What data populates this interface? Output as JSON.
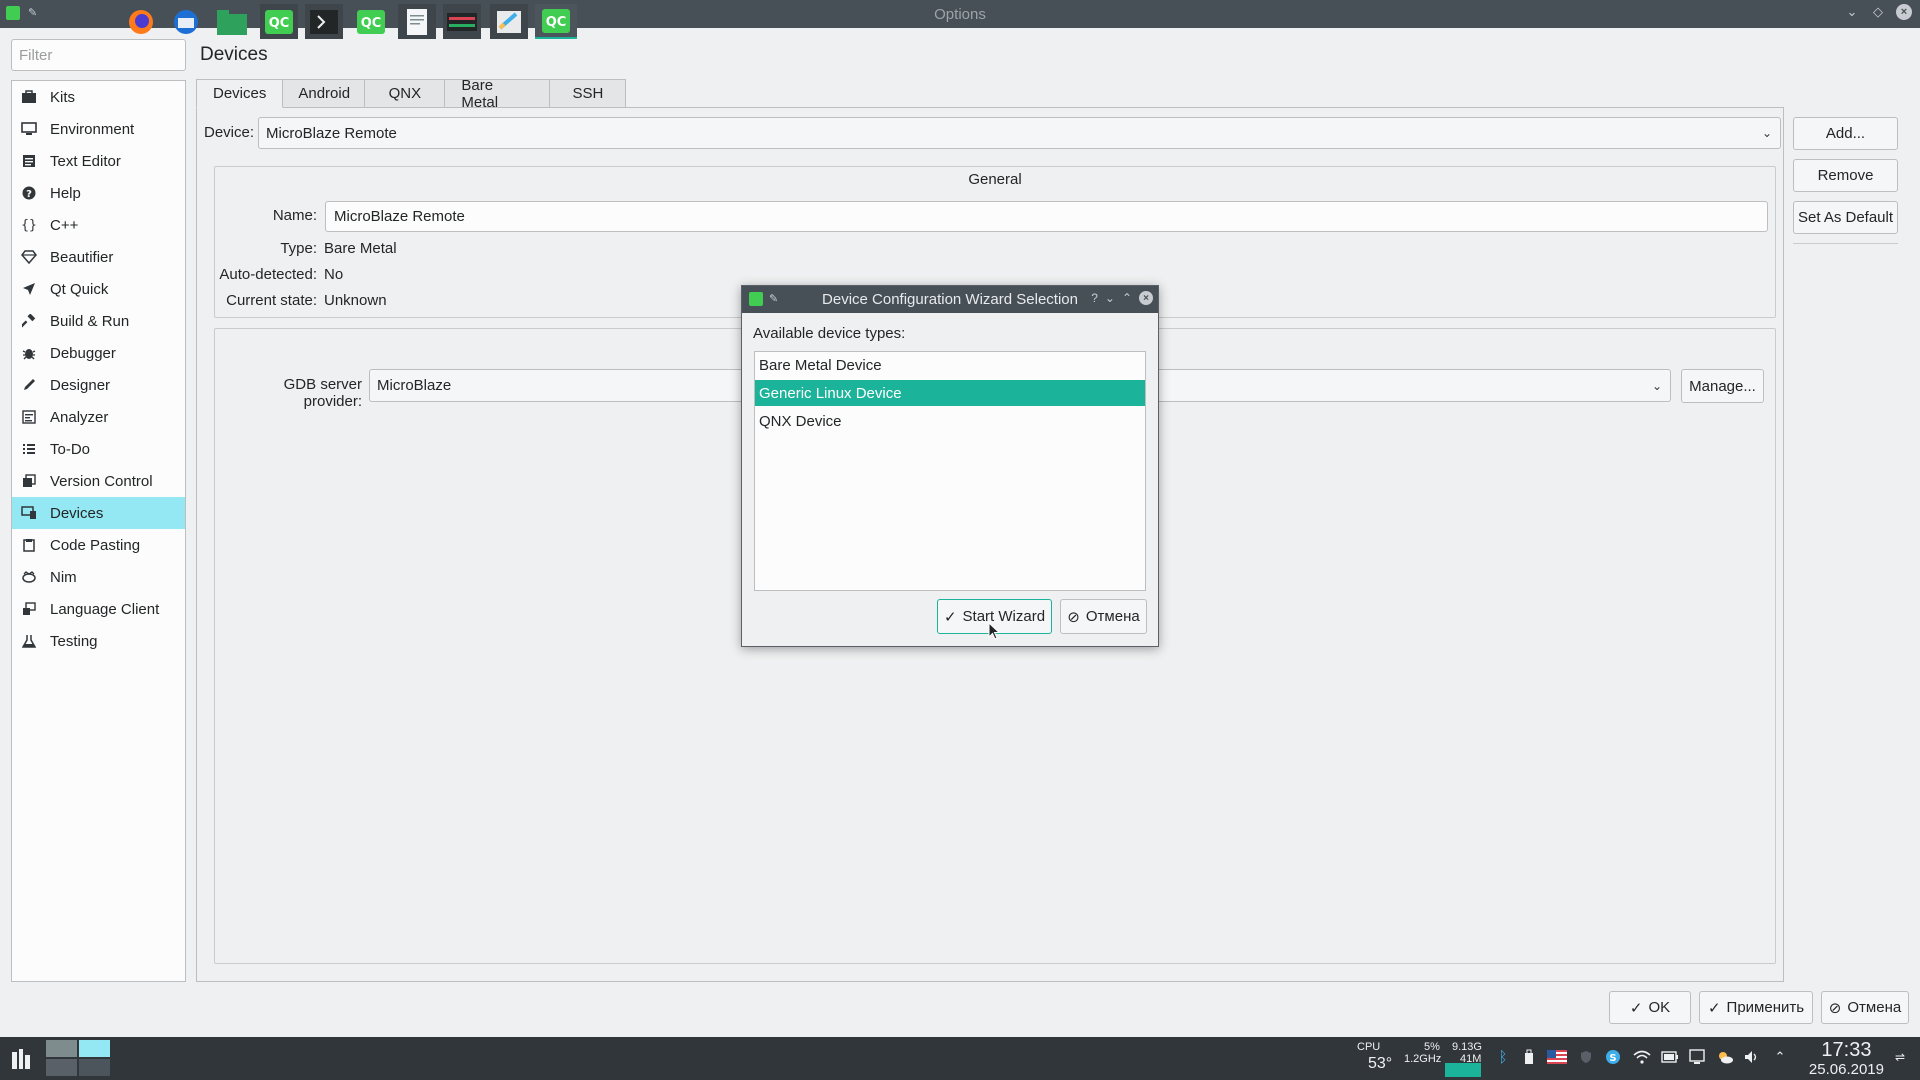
{
  "window": {
    "title": "Options"
  },
  "sidebar": {
    "filter_placeholder": "Filter",
    "items": [
      {
        "label": "Kits",
        "icon": "kits-icon"
      },
      {
        "label": "Environment",
        "icon": "monitor-icon"
      },
      {
        "label": "Text Editor",
        "icon": "text-editor-icon"
      },
      {
        "label": "Help",
        "icon": "help-icon"
      },
      {
        "label": "C++",
        "icon": "braces-icon"
      },
      {
        "label": "Beautifier",
        "icon": "diamond-icon"
      },
      {
        "label": "Qt Quick",
        "icon": "paper-plane-icon"
      },
      {
        "label": "Build & Run",
        "icon": "hammer-icon"
      },
      {
        "label": "Debugger",
        "icon": "bug-icon"
      },
      {
        "label": "Designer",
        "icon": "pencil-icon"
      },
      {
        "label": "Analyzer",
        "icon": "analyzer-icon"
      },
      {
        "label": "To-Do",
        "icon": "list-icon"
      },
      {
        "label": "Version Control",
        "icon": "version-control-icon"
      },
      {
        "label": "Devices",
        "icon": "devices-icon"
      },
      {
        "label": "Code Pasting",
        "icon": "clipboard-icon"
      },
      {
        "label": "Nim",
        "icon": "nim-icon"
      },
      {
        "label": "Language Client",
        "icon": "plugin-icon"
      },
      {
        "label": "Testing",
        "icon": "flask-icon"
      }
    ],
    "selected_index": 13
  },
  "main": {
    "title": "Devices",
    "tabs": [
      "Devices",
      "Android",
      "QNX",
      "Bare Metal",
      "SSH"
    ],
    "active_tab": 0,
    "device_label": "Device:",
    "device_value": "MicroBlaze Remote",
    "buttons": {
      "add": "Add...",
      "remove": "Remove",
      "set_default": "Set As Default"
    },
    "general": {
      "title": "General",
      "name_label": "Name:",
      "name_value": "MicroBlaze Remote",
      "type_label": "Type:",
      "type_value": "Bare Metal",
      "auto_label": "Auto-detected:",
      "auto_value": "No",
      "state_label": "Current state:",
      "state_value": "Unknown"
    },
    "gdb": {
      "label": "GDB server provider:",
      "value": "MicroBlaze",
      "manage": "Manage..."
    }
  },
  "footer": {
    "ok": "OK",
    "apply": "Применить",
    "cancel": "Отмена"
  },
  "dialog": {
    "title": "Device Configuration Wizard Selection",
    "help": "?",
    "label": "Available device types:",
    "items": [
      "Bare Metal Device",
      "Generic Linux Device",
      "QNX Device"
    ],
    "selected_index": 1,
    "start": "Start Wizard",
    "cancel": "Отмена"
  },
  "taskbar": {
    "cpu_label": "CPU",
    "cpu_temp": "53°",
    "cpu_load": "5%",
    "cpu_freq": "1.2GHz",
    "mem_total": "9.13G",
    "mem_used": "41M",
    "time": "17:33",
    "date": "25.06.2019"
  },
  "colors": {
    "titlebar": "#475057",
    "selection_sidebar": "#93e8f3",
    "selection_list": "#1cb39b",
    "taskbar": "#31363b"
  }
}
